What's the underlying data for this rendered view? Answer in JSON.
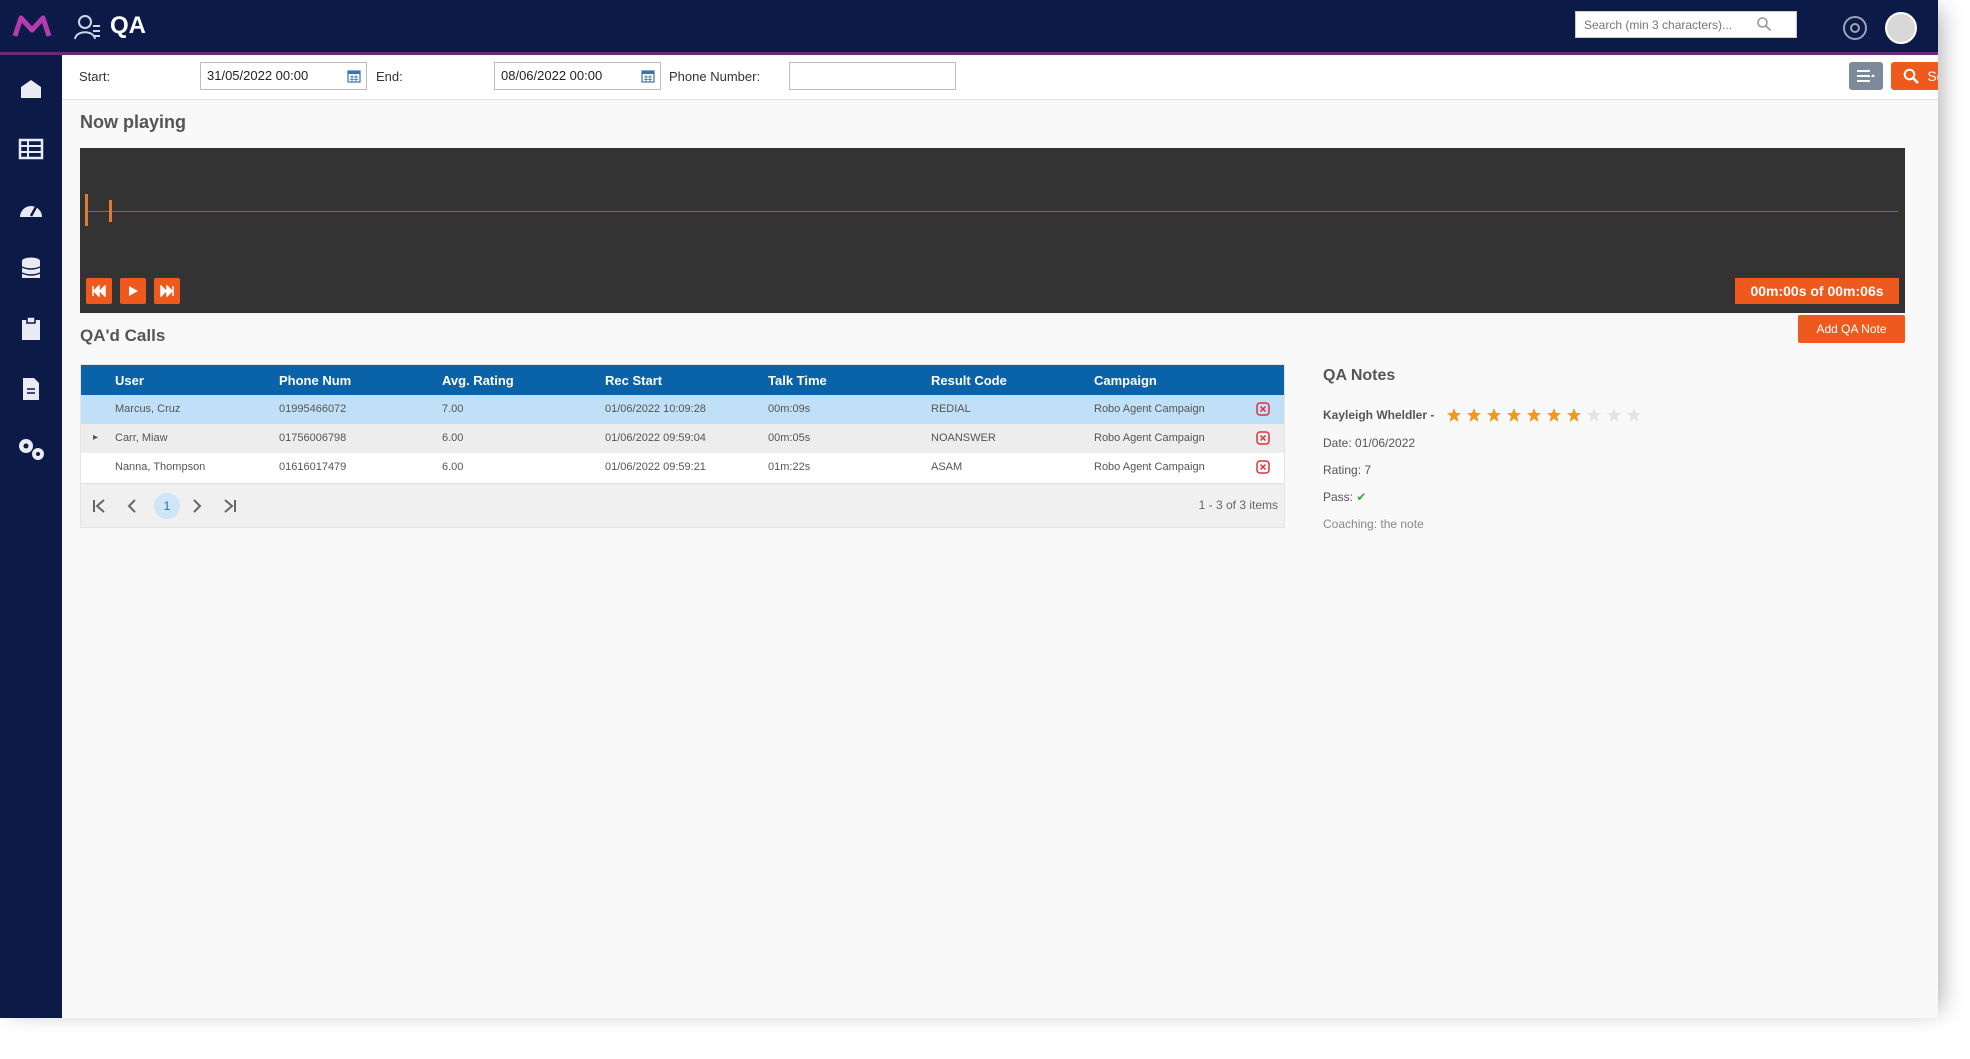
{
  "app": {
    "title": "QA",
    "search_placeholder": "Search (min 3 characters)..."
  },
  "sidebar": {
    "items": [
      {
        "icon": "home-icon"
      },
      {
        "icon": "dashboard-grid-icon"
      },
      {
        "icon": "speedometer-icon"
      },
      {
        "icon": "database-icon"
      },
      {
        "icon": "clipboard-icon"
      },
      {
        "icon": "document-icon"
      },
      {
        "icon": "settings-cogs-icon"
      }
    ]
  },
  "filters": {
    "start_label": "Start:",
    "start_value": "31/05/2022 00:00",
    "end_label": "End:",
    "end_value": "08/06/2022 00:00",
    "phone_label": "Phone Number:",
    "phone_value": "",
    "search_label": "Search"
  },
  "player": {
    "title": "Now playing",
    "time": "00m:00s of 00m:06s"
  },
  "calls": {
    "title": "QA'd Calls",
    "add_note_label": "Add QA Note",
    "columns": [
      "User",
      "Phone Num",
      "Avg. Rating",
      "Rec Start",
      "Talk Time",
      "Result Code",
      "Campaign"
    ],
    "rows": [
      {
        "expand": "",
        "user": "Marcus, Cruz",
        "phone": "01995466072",
        "rating": "7.00",
        "start": "01/06/2022 10:09:28",
        "talk": "00m:09s",
        "result": "REDIAL",
        "campaign": "Robo Agent Campaign",
        "selected": true
      },
      {
        "expand": "▸",
        "user": "Carr, Miaw",
        "phone": "01756006798",
        "rating": "6.00",
        "start": "01/06/2022 09:59:04",
        "talk": "00m:05s",
        "result": "NOANSWER",
        "campaign": "Robo Agent Campaign",
        "selected": false
      },
      {
        "expand": "",
        "user": "Nanna, Thompson",
        "phone": "01616017479",
        "rating": "6.00",
        "start": "01/06/2022 09:59:21",
        "talk": "01m:22s",
        "result": "ASAM",
        "campaign": "Robo Agent Campaign",
        "selected": false
      }
    ],
    "pager": {
      "current_page": "1",
      "info": "1 - 3 of 3 items"
    }
  },
  "qa_notes": {
    "title": "QA Notes",
    "author": "Kayleigh Wheldler -",
    "stars_filled": 7,
    "stars_total": 10,
    "date": "Date: 01/06/2022",
    "rating": "Rating: 7",
    "pass_label": "Pass:",
    "pass_mark": "✔",
    "comment": "Coaching: the note"
  },
  "colors": {
    "nav": "#0b1a46",
    "accent": "#ee5a1e",
    "grid_header": "#0a62a8",
    "selected_row": "#bfe0f7"
  }
}
